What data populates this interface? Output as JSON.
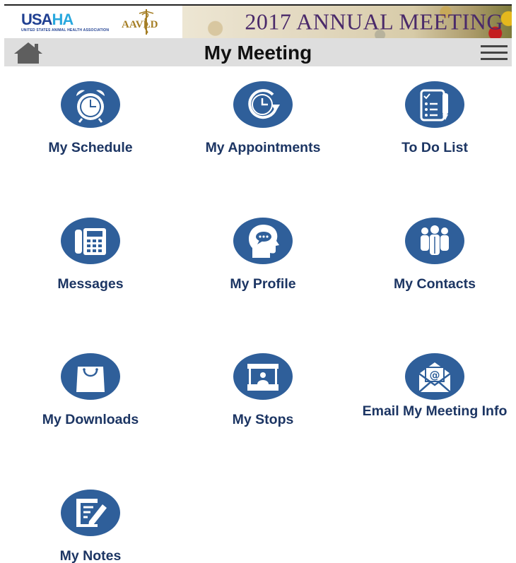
{
  "banner": {
    "usaha_logo": "USAHA",
    "usaha_subtitle": "UNITED STATES ANIMAL HEALTH ASSOCIATION",
    "aavld_logo": "AAVLD",
    "title": "2017 ANNUAL MEETING"
  },
  "navbar": {
    "title": "My Meeting",
    "home_icon": "home-icon",
    "menu_icon": "hamburger-menu-icon"
  },
  "tiles": [
    {
      "label": "My Schedule",
      "icon": "alarm-clock-icon"
    },
    {
      "label": "My Appointments",
      "icon": "clock-arrow-icon"
    },
    {
      "label": "To Do List",
      "icon": "checklist-icon"
    },
    {
      "label": "Messages",
      "icon": "telephone-icon"
    },
    {
      "label": "My Profile",
      "icon": "head-speech-icon"
    },
    {
      "label": "My Contacts",
      "icon": "people-group-icon"
    },
    {
      "label": "My Downloads",
      "icon": "shopping-bag-icon"
    },
    {
      "label": "My Stops",
      "icon": "booth-icon"
    },
    {
      "label": "Email My Meeting Info",
      "icon": "email-envelope-icon"
    },
    {
      "label": "My Notes",
      "icon": "notes-pen-icon"
    }
  ],
  "colors": {
    "icon_circle": "#2f5f9a",
    "label_text": "#1c3563",
    "navbar_bg": "#dedede",
    "banner_title": "#4a2a6a"
  }
}
